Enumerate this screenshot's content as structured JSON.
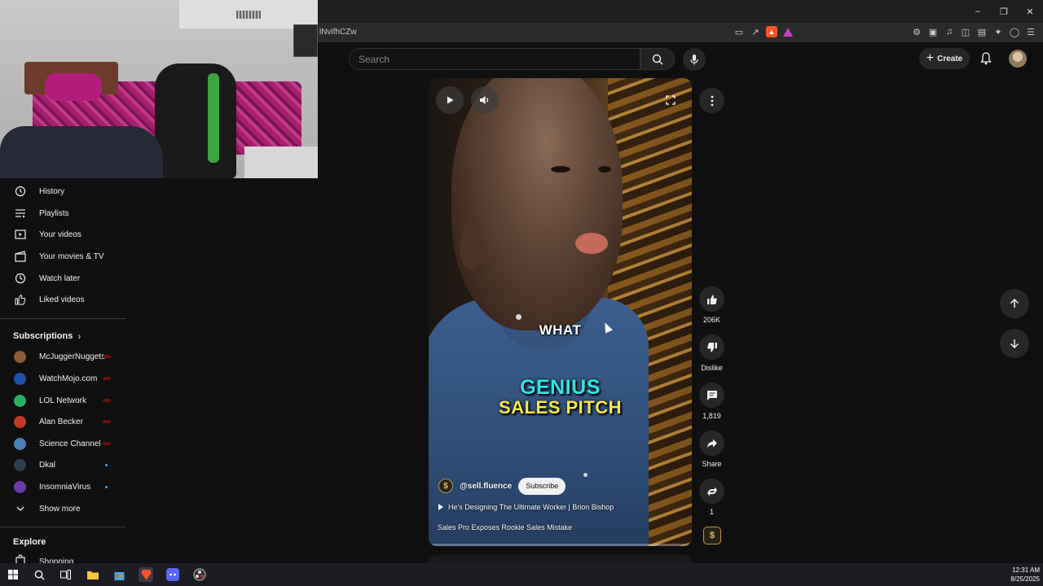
{
  "browser": {
    "url_fragment": "lNvifhCZw",
    "window_controls": [
      "minimize-icon",
      "restore-icon",
      "close-icon"
    ]
  },
  "header": {
    "search_placeholder": "Search",
    "create_label": "Create"
  },
  "sidebar": {
    "you_items": [
      {
        "label": "History",
        "icon": "history-icon"
      },
      {
        "label": "Playlists",
        "icon": "playlists-icon"
      },
      {
        "label": "Your videos",
        "icon": "your-videos-icon"
      },
      {
        "label": "Your movies & TV",
        "icon": "movies-icon"
      },
      {
        "label": "Watch later",
        "icon": "watch-later-icon"
      },
      {
        "label": "Liked videos",
        "icon": "liked-videos-icon"
      }
    ],
    "subscriptions_heading": "Subscriptions",
    "subscriptions": [
      {
        "name": "McJuggerNuggets",
        "indicator": "live",
        "avatar_color": "#8a5a3a"
      },
      {
        "name": "WatchMojo.com",
        "indicator": "live",
        "avatar_color": "#1f4fa8"
      },
      {
        "name": "LOL Network",
        "indicator": "live",
        "avatar_color": "#27ae60"
      },
      {
        "name": "Alan Becker",
        "indicator": "live",
        "avatar_color": "#c0392b"
      },
      {
        "name": "Science Channel",
        "indicator": "live",
        "avatar_color": "#4a7fb5"
      },
      {
        "name": "Dkal",
        "indicator": "dot",
        "avatar_color": "#2c3e50"
      },
      {
        "name": "InsomniaVirus",
        "indicator": "dot",
        "avatar_color": "#6c3aa8"
      }
    ],
    "show_more": "Show more",
    "explore_heading": "Explore",
    "explore_items": [
      {
        "label": "Shopping",
        "icon": "shopping-bag-icon"
      }
    ]
  },
  "short": {
    "caption_line1": "WHAT",
    "caption_line2": "GENIUS",
    "caption_line3": "SALES PITCH",
    "channel_handle": "@sell.fluence",
    "subscribe_label": "Subscribe",
    "related_video": "He's Designing The Ultimate Worker | Brion Bishop",
    "description": "Sales Pro Exposes Rookie Sales Mistake",
    "progress_fraction": 0.0
  },
  "actions": {
    "likes": "206K",
    "dislike_label": "Dislike",
    "comments": "1,819",
    "share_label": "Share",
    "remix_count": "1"
  },
  "taskbar": {
    "time": "12:31 AM",
    "date": "8/25/2025"
  },
  "colors": {
    "background": "#0f0f0f",
    "caption_cyan": "#2ee5e5",
    "caption_yellow": "#f7e94a",
    "live_dot": "#3ea6ff"
  }
}
